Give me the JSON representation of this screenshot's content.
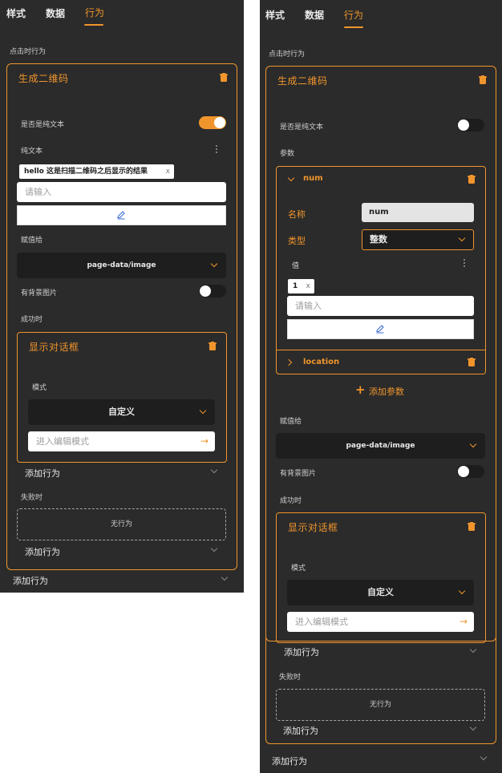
{
  "tabs": [
    {
      "label": "样式"
    },
    {
      "label": "数据"
    },
    {
      "label": "行为"
    }
  ],
  "section_title": "点击时行为",
  "action": {
    "title": "生成二维码",
    "plain_text_toggle_label": "是否是纯文本",
    "plain_text_label": "纯文本",
    "params_label": "参数",
    "tag_text": "hello 这是扫描二维码之后显示的结果",
    "tag_close": "x",
    "input_placeholder": "请输入",
    "assign_label": "赋值给",
    "assign_value": "page-data/image",
    "bg_image_label": "有背景图片",
    "success_label": "成功时",
    "fail_label": "失败时",
    "no_action": "无行为",
    "add_action": "添加行为"
  },
  "param": {
    "name": "num",
    "name_label": "名称",
    "name_value": "num",
    "type_label": "类型",
    "type_value": "整数",
    "value_label": "值",
    "value_tag": "1",
    "value_tag_close": "x",
    "input_placeholder": "请输入",
    "second_param": "location",
    "add_param": "添加参数"
  },
  "dialog": {
    "title": "显示对话框",
    "mode_label": "模式",
    "mode_value": "自定义",
    "edit_mode_placeholder": "进入编辑模式"
  },
  "colors": {
    "accent": "#f0952c",
    "panel_bg": "#2b2b2b",
    "select_bg": "#1e1e1e"
  }
}
